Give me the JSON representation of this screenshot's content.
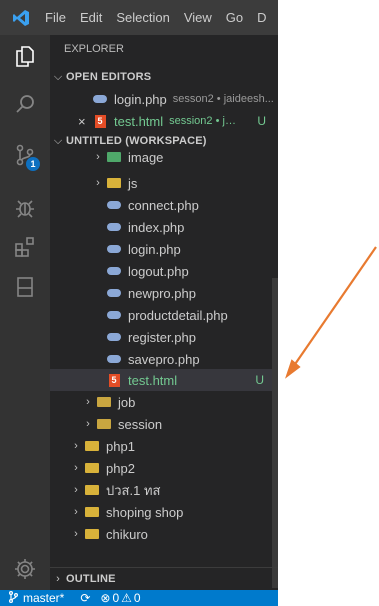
{
  "menubar": {
    "logo": "vscode-logo-icon",
    "items": [
      "File",
      "Edit",
      "Selection",
      "View",
      "Go",
      "D"
    ]
  },
  "activitybar": {
    "icons": [
      "explorer-icon",
      "search-icon",
      "source-control-icon",
      "debug-icon",
      "extensions-icon",
      "remote-explorer-icon",
      "settings-gear-icon"
    ],
    "source_control_badge": "1"
  },
  "sidebar": {
    "title": "EXPLORER",
    "open_editors": {
      "header": "OPEN EDITORS",
      "items": [
        {
          "name": "login.php",
          "folder": "sesson2 • jaideesh..."
        },
        {
          "name": "test.html",
          "folder": "session2 • jai...",
          "status": "U"
        }
      ]
    },
    "workspace": {
      "header": "UNTITLED (WORKSPACE)",
      "tree": {
        "image": "image",
        "js": "js",
        "files": [
          "connect.php",
          "index.php",
          "login.php",
          "logout.php",
          "newpro.php",
          "productdetail.php",
          "register.php",
          "savepro.php"
        ],
        "test_html": "test.html",
        "test_status": "U",
        "job": "job",
        "session": "session",
        "roots": [
          "php1",
          "php2",
          "ปวส.1 ทส",
          "shoping shop",
          "chikuro"
        ]
      }
    },
    "outline": "OUTLINE"
  },
  "statusbar": {
    "branch": "master*",
    "sync": "sync-icon",
    "errors": "0",
    "warnings": "0"
  },
  "colors": {
    "activity_bar": "#333333",
    "sidebar": "#252526",
    "status_bar": "#007acc",
    "arrow": "#e87a30",
    "untracked": "#73c991"
  }
}
